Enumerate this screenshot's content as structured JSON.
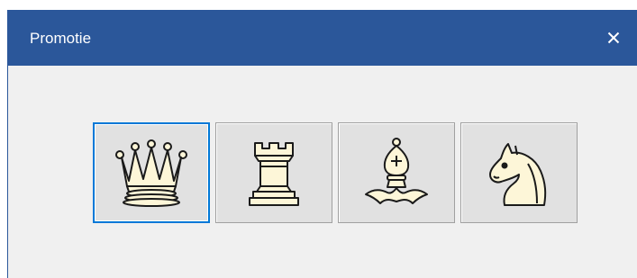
{
  "dialog": {
    "title": "Promotie",
    "close_icon": "close-icon"
  },
  "pieces": [
    {
      "name": "queen",
      "icon": "white-queen-icon",
      "selected": true
    },
    {
      "name": "rook",
      "icon": "white-rook-icon",
      "selected": false
    },
    {
      "name": "bishop",
      "icon": "white-bishop-icon",
      "selected": false
    },
    {
      "name": "knight",
      "icon": "white-knight-icon",
      "selected": false
    }
  ],
  "colors": {
    "titlebar": "#2b579a",
    "dialog_bg": "#f0f0f0",
    "button_bg": "#e1e1e1",
    "focus_border": "#0078d7",
    "piece_fill": "#fdf6d8",
    "piece_outline": "#1a1a1a"
  }
}
